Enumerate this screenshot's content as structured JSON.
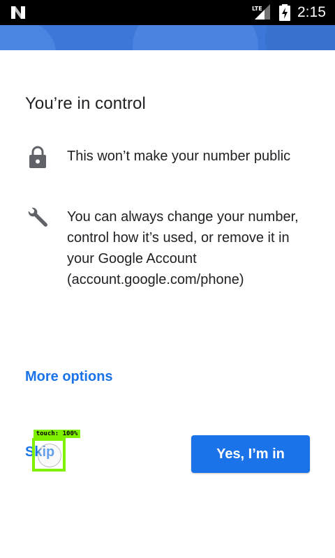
{
  "status_bar": {
    "time": "2:15",
    "network": "LTE",
    "icons": [
      "n-logo-icon",
      "lte-signal-icon",
      "battery-charging-icon"
    ]
  },
  "colors": {
    "accent": "#1a73e8",
    "header_band": "#3d78d8",
    "text": "#202124",
    "touch_overlay": "#7ff000"
  },
  "main": {
    "title": "You’re in control",
    "items": [
      {
        "icon": "lock-icon",
        "text": "This won’t make your number public"
      },
      {
        "icon": "wrench-icon",
        "text": "You can always change your number, control how it’s used, or remove it in your Google Account (account.google.com/phone)"
      }
    ],
    "more_options": "More options"
  },
  "actions": {
    "skip_label": "Skip",
    "confirm_label": "Yes, I’m in"
  },
  "touch_indicator": {
    "label": "touch: 100%"
  }
}
